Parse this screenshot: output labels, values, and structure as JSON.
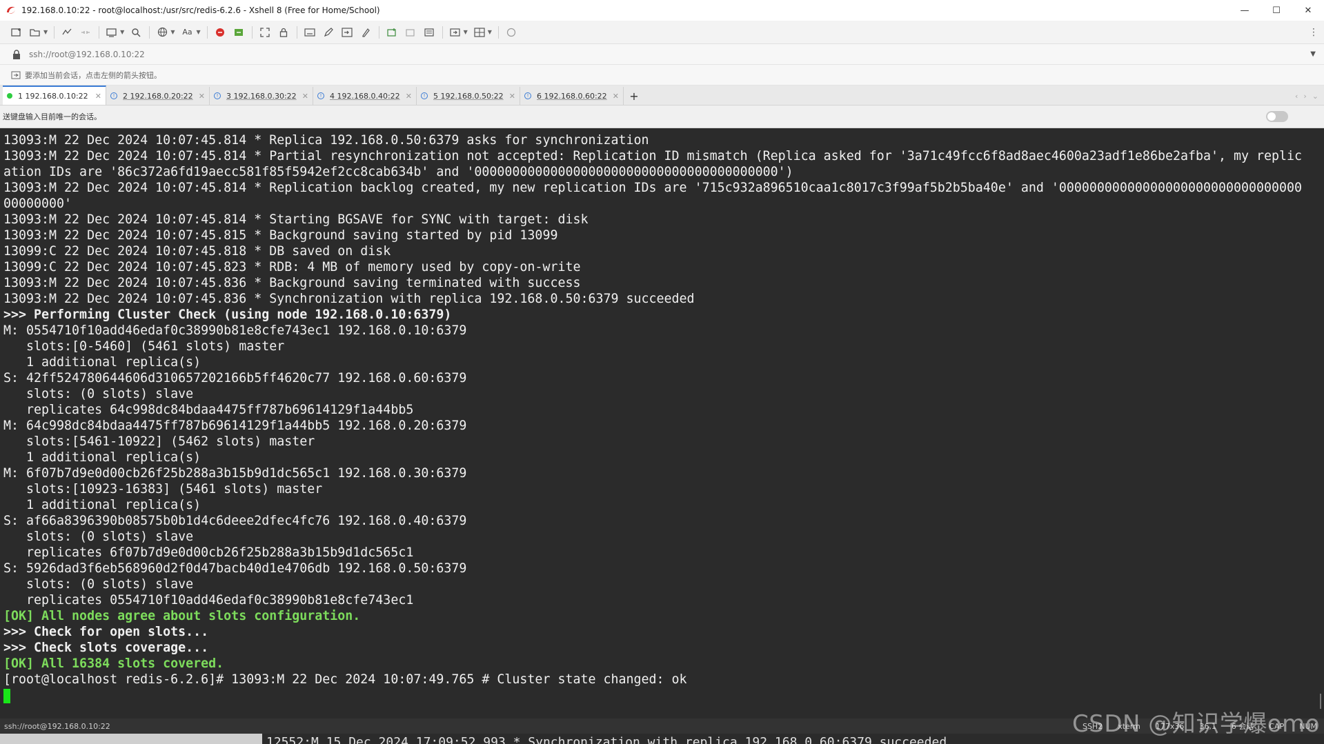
{
  "window": {
    "title": "192.168.0.10:22 - root@localhost:/usr/src/redis-6.2.6 - Xshell 8 (Free for Home/School)",
    "minimize": "—",
    "maximize": "☐",
    "close": "✕"
  },
  "toolbar": {
    "font_label": "Aa"
  },
  "address": {
    "url": "ssh://root@192.168.0.10:22"
  },
  "hint": {
    "text": "要添加当前会话，点击左侧的箭头按钮。"
  },
  "tabs": [
    {
      "label": "1 192.168.0.10:22",
      "status": "connected",
      "active": true
    },
    {
      "label": "2 192.168.0.20:22",
      "status": "info",
      "active": false
    },
    {
      "label": "3 192.168.0.30:22",
      "status": "info",
      "active": false
    },
    {
      "label": "4 192.168.0.40:22",
      "status": "info",
      "active": false
    },
    {
      "label": "5 192.168.0.50:22",
      "status": "info",
      "active": false
    },
    {
      "label": "6 192.168.0.60:22",
      "status": "info",
      "active": false
    }
  ],
  "tab_add": "+",
  "inputbar": {
    "text": "送键盘输入目前唯一的会话。"
  },
  "terminal": {
    "lines": [
      {
        "text": "13093:M 22 Dec 2024 10:07:45.814 * Replica 192.168.0.50:6379 asks for synchronization",
        "style": "normal"
      },
      {
        "text": "13093:M 22 Dec 2024 10:07:45.814 * Partial resynchronization not accepted: Replication ID mismatch (Replica asked for '3a71c49fcc6f8ad8aec4600a23adf1e86be2afba', my replic",
        "style": "normal"
      },
      {
        "text": "ation IDs are '86c372a6fd19aecc581f85f5942ef2cc8cab634b' and '0000000000000000000000000000000000000000')",
        "style": "normal"
      },
      {
        "text": "13093:M 22 Dec 2024 10:07:45.814 * Replication backlog created, my new replication IDs are '715c932a896510caa1c8017c3f99af5b2b5ba40e' and '00000000000000000000000000000000",
        "style": "normal"
      },
      {
        "text": "00000000'",
        "style": "normal"
      },
      {
        "text": "13093:M 22 Dec 2024 10:07:45.814 * Starting BGSAVE for SYNC with target: disk",
        "style": "normal"
      },
      {
        "text": "13093:M 22 Dec 2024 10:07:45.815 * Background saving started by pid 13099",
        "style": "normal"
      },
      {
        "text": "13099:C 22 Dec 2024 10:07:45.818 * DB saved on disk",
        "style": "normal"
      },
      {
        "text": "13099:C 22 Dec 2024 10:07:45.823 * RDB: 4 MB of memory used by copy-on-write",
        "style": "normal"
      },
      {
        "text": "13093:M 22 Dec 2024 10:07:45.836 * Background saving terminated with success",
        "style": "normal"
      },
      {
        "text": "13093:M 22 Dec 2024 10:07:45.836 * Synchronization with replica 192.168.0.50:6379 succeeded",
        "style": "normal"
      },
      {
        "text": ">>> Performing Cluster Check (using node 192.168.0.10:6379)",
        "style": "hdr"
      },
      {
        "text": "M: 0554710f10add46edaf0c38990b81e8cfe743ec1 192.168.0.10:6379",
        "style": "normal"
      },
      {
        "text": "   slots:[0-5460] (5461 slots) master",
        "style": "normal"
      },
      {
        "text": "   1 additional replica(s)",
        "style": "normal"
      },
      {
        "text": "S: 42ff524780644606d310657202166b5ff4620c77 192.168.0.60:6379",
        "style": "normal"
      },
      {
        "text": "   slots: (0 slots) slave",
        "style": "normal"
      },
      {
        "text": "   replicates 64c998dc84bdaa4475ff787b69614129f1a44bb5",
        "style": "normal"
      },
      {
        "text": "M: 64c998dc84bdaa4475ff787b69614129f1a44bb5 192.168.0.20:6379",
        "style": "normal"
      },
      {
        "text": "   slots:[5461-10922] (5462 slots) master",
        "style": "normal"
      },
      {
        "text": "   1 additional replica(s)",
        "style": "normal"
      },
      {
        "text": "M: 6f07b7d9e0d00cb26f25b288a3b15b9d1dc565c1 192.168.0.30:6379",
        "style": "normal"
      },
      {
        "text": "   slots:[10923-16383] (5461 slots) master",
        "style": "normal"
      },
      {
        "text": "   1 additional replica(s)",
        "style": "normal"
      },
      {
        "text": "S: af66a8396390b08575b0b1d4c6deee2dfec4fc76 192.168.0.40:6379",
        "style": "normal"
      },
      {
        "text": "   slots: (0 slots) slave",
        "style": "normal"
      },
      {
        "text": "   replicates 6f07b7d9e0d00cb26f25b288a3b15b9d1dc565c1",
        "style": "normal"
      },
      {
        "text": "S: 5926dad3f6eb568960d2f0d47bacb40d1e4706db 192.168.0.50:6379",
        "style": "normal"
      },
      {
        "text": "   slots: (0 slots) slave",
        "style": "normal"
      },
      {
        "text": "   replicates 0554710f10add46edaf0c38990b81e8cfe743ec1",
        "style": "normal"
      },
      {
        "text": "[OK] All nodes agree about slots configuration.",
        "style": "ok"
      },
      {
        "text": ">>> Check for open slots...",
        "style": "hdr"
      },
      {
        "text": ">>> Check slots coverage...",
        "style": "hdr"
      },
      {
        "text": "[OK] All 16384 slots covered.",
        "style": "ok"
      },
      {
        "text": "[root@localhost redis-6.2.6]# 13093:M 22 Dec 2024 10:07:49.765 # Cluster state changed: ok",
        "style": "normal"
      }
    ]
  },
  "status": {
    "left": "ssh://root@192.168.0.10:22",
    "protocol": "SSH2",
    "term": "xterm",
    "size": "177x36",
    "pos": "36,1",
    "sessions": "6 会话",
    "caps": "CAP",
    "num": "NUM"
  },
  "background_peek": {
    "text": "12552:M 15 Dec 2024 17:09:52.993 * Synchronization with replica 192.168.0.60:6379 succeeded"
  },
  "watermark": "CSDN @知识学爆omo",
  "colors": {
    "terminal_bg": "#2b2b2b",
    "terminal_fg": "#f0f0f0",
    "ok_green": "#7ddc5c",
    "cursor_green": "#19e619",
    "tab_connected": "#2ecc40"
  }
}
